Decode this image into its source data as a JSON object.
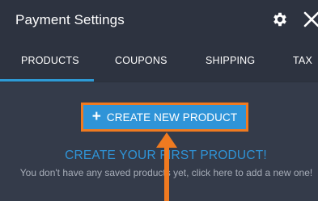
{
  "header": {
    "title": "Payment Settings",
    "settings_icon": "gear-icon",
    "close_icon": "close-icon"
  },
  "tabs": [
    {
      "label": "PRODUCTS",
      "active": true
    },
    {
      "label": "COUPONS",
      "active": false
    },
    {
      "label": "SHIPPING",
      "active": false
    },
    {
      "label": "TAX",
      "active": false
    }
  ],
  "main": {
    "create_button_label": "CREATE NEW PRODUCT",
    "create_button_icon": "plus-icon",
    "empty_title": "CREATE YOUR FIRST PRODUCT!",
    "empty_subtitle": "You don't have any saved products yet, click here to add a new one!"
  },
  "colors": {
    "header_bg": "#2d3340",
    "body_bg": "#343b4a",
    "accent_blue": "#2f94d8",
    "highlight_orange": "#f07a20",
    "active_tab_bar": "#2e9bd6"
  }
}
